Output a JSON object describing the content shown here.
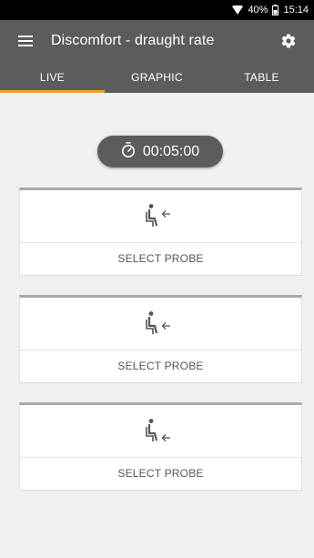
{
  "status_bar": {
    "battery": "40%",
    "time": "15:14"
  },
  "app_bar": {
    "title": "Discomfort - draught rate"
  },
  "tabs": [
    {
      "label": "LIVE",
      "active": true
    },
    {
      "label": "GRAPHIC",
      "active": false
    },
    {
      "label": "TABLE",
      "active": false
    }
  ],
  "timer": {
    "value": "00:05:00"
  },
  "probes": [
    {
      "label": "SELECT PROBE",
      "icon": "seated-person-arrow-icon"
    },
    {
      "label": "SELECT PROBE",
      "icon": "seated-person-arrow-icon"
    },
    {
      "label": "SELECT PROBE",
      "icon": "seated-person-arrow-icon"
    }
  ],
  "colors": {
    "app_bar": "#5c5c5c",
    "accent": "#f0a52a",
    "background": "#f0f0f0"
  }
}
